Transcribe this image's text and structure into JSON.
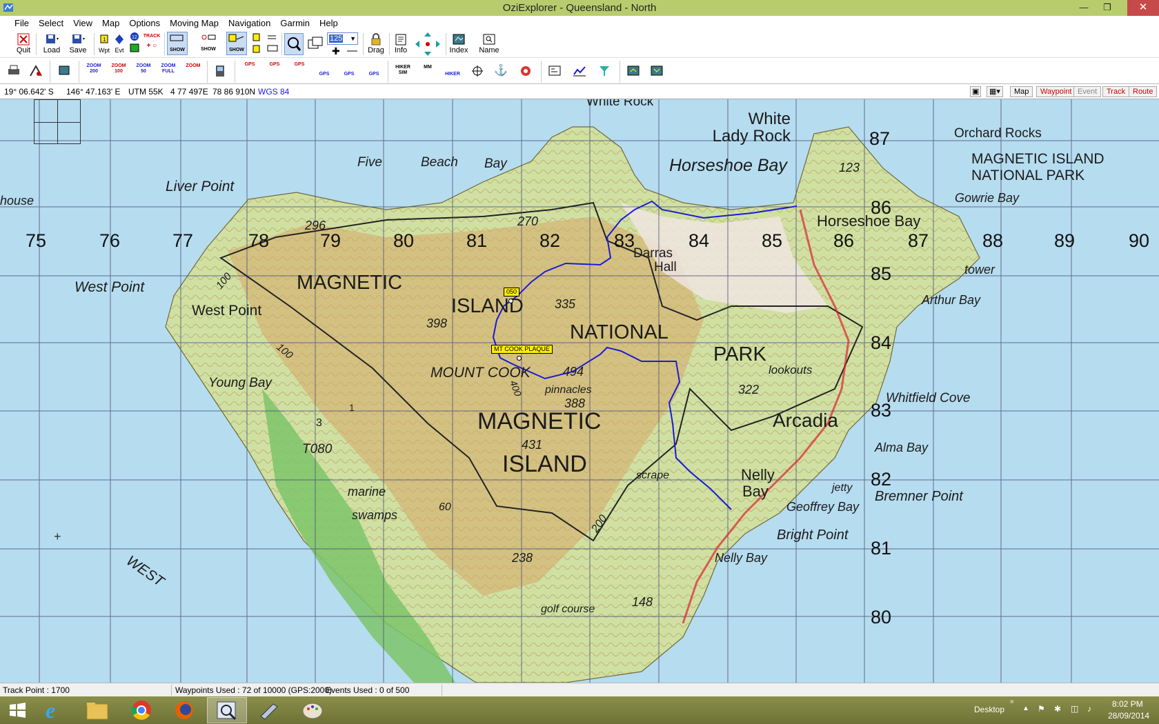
{
  "window": {
    "title": "OziExplorer - Queensland - North"
  },
  "menu": [
    "File",
    "Select",
    "View",
    "Map",
    "Options",
    "Moving Map",
    "Navigation",
    "Garmin",
    "Help"
  ],
  "toolbar1": {
    "quit": "Quit",
    "load": "Load",
    "save": "Save",
    "wpt": "Wpt",
    "evt": "Evt",
    "track_mini": "TRACK",
    "show1": "SHOW",
    "show2": "SHOW",
    "show3": "SHOW",
    "zoom_value": "125",
    "drag": "Drag",
    "info": "Info",
    "index": "Index",
    "name": "Name"
  },
  "toolbar2": {
    "zoom200": "ZOOM 200",
    "zoom100": "ZOOM 100",
    "zoom50": "ZOOM 50",
    "zoomfull": "ZOOM FULL",
    "zoom_blank": "ZOOM",
    "gps1": "GPS",
    "gps2": "GPS",
    "gps3": "GPS",
    "gps4": "GPS",
    "gps5": "GPS",
    "gps6": "GPS",
    "hiker_sim": "HIKER SIM",
    "mm": "MM",
    "hiker": "HIKER"
  },
  "coords": {
    "lat": "19° 06.642' S",
    "lon": "146° 47.163' E",
    "utm": "UTM  55K",
    "easting": "4 77 497E",
    "northing": "78 86 910N",
    "datum": "WGS 84"
  },
  "object_buttons": {
    "map": "Map",
    "waypoint": "Waypoint",
    "event": "Event",
    "track": "Track",
    "route": "Route"
  },
  "colors": {
    "active_object": "#cc0000",
    "disabled_object": "#888888",
    "track_line": "#1a1ad6",
    "waypoint_flag": "#ffee00",
    "datum": "#1a1ad6"
  },
  "map": {
    "grid_eastings": [
      "75",
      "76",
      "77",
      "78",
      "79",
      "80",
      "81",
      "82",
      "83",
      "84",
      "85",
      "86",
      "87",
      "88",
      "89",
      "90"
    ],
    "grid_northings": [
      "87",
      "86",
      "85",
      "84",
      "83",
      "82",
      "81",
      "80"
    ],
    "place_labels": {
      "white_rock": "White Rock",
      "white_lady_rock": "White Lady Rock",
      "orchard_rocks": "Orchard Rocks",
      "park1": "MAGNETIC ISLAND",
      "park2": "NATIONAL PARK",
      "horseshoe_bay": "Horseshoe Bay",
      "horseshoe_bay2": "Horseshoe Bay",
      "gowrie_bay": "Gowrie Bay",
      "five": "Five",
      "beach": "Beach",
      "bay": "Bay",
      "liver_point": "Liver Point",
      "house": "house",
      "west_point_sea": "West Point",
      "west_point": "West Point",
      "magnetic": "MAGNETIC",
      "island": "ISLAND",
      "national": "NATIONAL",
      "park": "PARK",
      "arthur_bay": "Arthur Bay",
      "tower": "tower",
      "darras": "Darras",
      "hall": "Hall",
      "lookouts": "lookouts",
      "whitfield_cove": "Whitfield Cove",
      "arcadia": "Arcadia",
      "alma_bay": "Alma Bay",
      "mount_cook": "MOUNT COOK",
      "pinnacles": "pinnacles",
      "magnetic_big": "MAGNETIC",
      "island_big": "ISLAND",
      "young_bay": "Young Bay",
      "t080": "T080",
      "marine": "marine",
      "swamps": "swamps",
      "scrape": "scrape",
      "nelly": "Nelly",
      "bay_n": "Bay",
      "jetty": "jetty",
      "bremner_point": "Bremner Point",
      "geoffrey_bay": "Geoffrey Bay",
      "bright_point": "Bright Point",
      "nelly_bay": "Nelly Bay",
      "golf_course": "golf course",
      "west": "WEST"
    },
    "heights": {
      "h296": "296",
      "h270": "270",
      "h123": "123",
      "h335": "335",
      "h398": "398",
      "h494": "494",
      "h388": "388",
      "h431": "431",
      "h322": "322",
      "h238": "238",
      "h148": "148",
      "h60": "60",
      "h200": "200",
      "h100a": "100",
      "h100b": "100",
      "h400": "400",
      "h3": "3",
      "h1": "1"
    },
    "waypoints": [
      {
        "name": "050"
      },
      {
        "name": "MT COOK PLAQUE"
      }
    ]
  },
  "status": {
    "track_point": "Track Point : 1700",
    "waypoints_used": "Waypoints Used : 72 of 10000  (GPS:2000)",
    "events_used": "Events Used : 0 of 500"
  },
  "taskbar": {
    "desktop": "Desktop",
    "time": "8:02 PM",
    "date": "28/09/2014"
  }
}
